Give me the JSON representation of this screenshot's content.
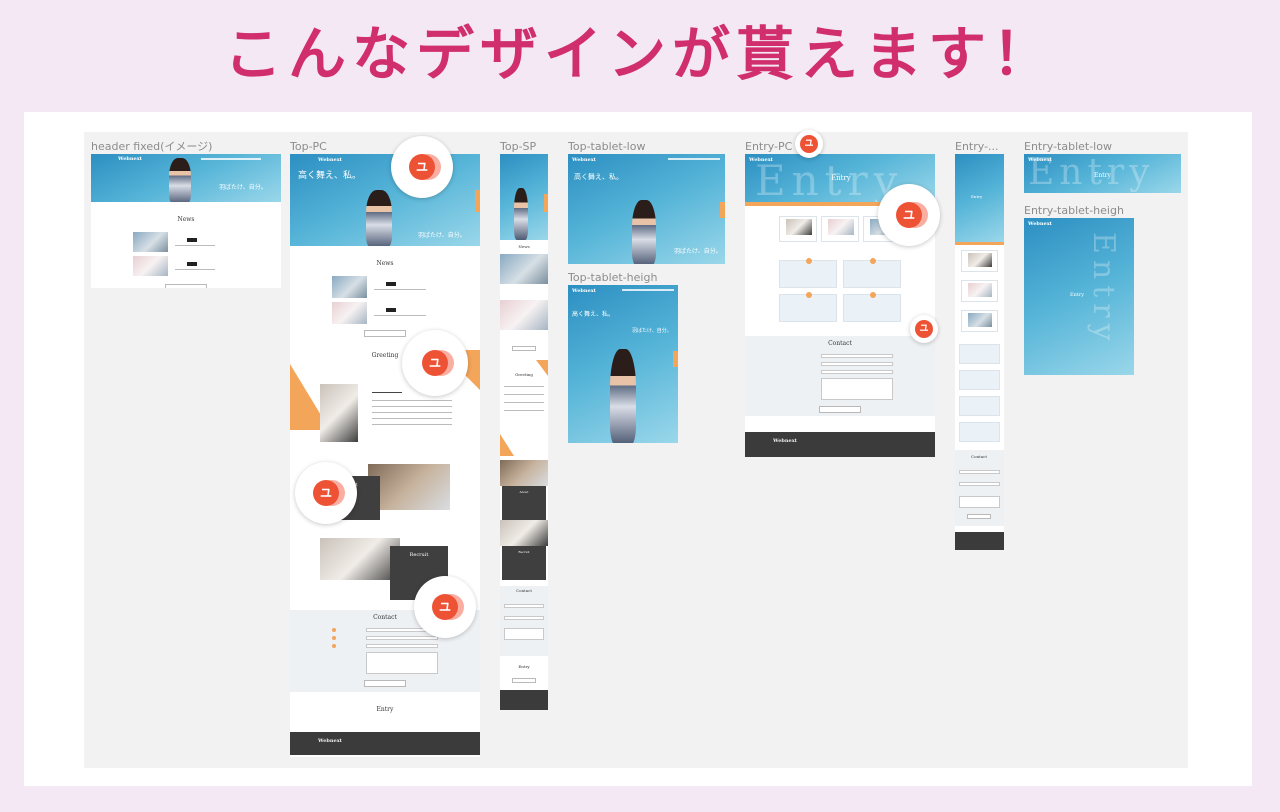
{
  "headline": "こんなデザインが貰えます！",
  "badge_char": "ユ",
  "labels": {
    "header_fixed": "header fixed(イメージ)",
    "top_pc": "Top-PC",
    "top_sp": "Top-SP",
    "top_tablet_low": "Top-tablet-low",
    "top_tablet_heigh": "Top-tablet-heigh",
    "entry_pc": "Entry-PC",
    "entry_sp": "Entry-...",
    "entry_tablet_low": "Entry-tablet-low",
    "entry_tablet_heigh": "Entry-tablet-heigh"
  },
  "mock": {
    "logo": "Webnext",
    "hero_catch": "高く舞え、私。",
    "hero_sub": "羽ばたけ、自分。",
    "news": "News",
    "greeting": "Greeting",
    "about": "About",
    "recruit": "Recruit",
    "contact": "Contact",
    "entry": "Entry",
    "entry_watermark": "Entry"
  },
  "colors": {
    "headline": "#d02e6d",
    "accent_orange": "#f3a55a",
    "badge_red": "#ee5235",
    "footer": "#3b3b3b"
  }
}
